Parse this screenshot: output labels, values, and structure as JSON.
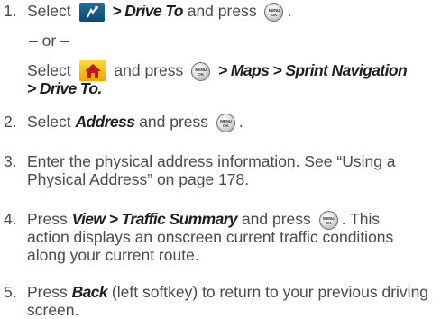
{
  "steps": [
    {
      "num": "1.",
      "lead": "Select",
      "drive_to": "> Drive To",
      "and_press": " and press",
      "period": ".",
      "or": "– or –",
      "select2": "Select",
      "and_press2": "and press",
      "path_a": "> Maps > Sprint Navigation",
      "path_b": "> Drive To."
    },
    {
      "num": "2.",
      "lead": "Select ",
      "address": "Address",
      "and_press": " and press",
      "period": "."
    },
    {
      "num": "3.",
      "text": "Enter the physical address information. See “Using a Physical Address” on page 178."
    },
    {
      "num": "4.",
      "lead": "Press ",
      "view": "View",
      "summary": " > Traffic Summary",
      "and_press": " and press",
      "this_text": ". This",
      "rest": "action displays an onscreen current traffic conditions along your current route."
    },
    {
      "num": "5.",
      "lead": "Press ",
      "back": "Back",
      "rest": " (left softkey) to return to your previous driving screen."
    }
  ],
  "icons": {
    "ok_key": "menu-ok-key-icon",
    "navigation": "navigation-app-icon",
    "home": "home-icon",
    "ok_key_top": "MENU",
    "ok_key_bottom": "OK"
  },
  "colors": {
    "text": "#4a4a4a",
    "emphasis": "#1e1e1e",
    "navigation_icon": "#0c4a73",
    "home_icon": "#f0a600",
    "home_roof": "#c01818"
  }
}
